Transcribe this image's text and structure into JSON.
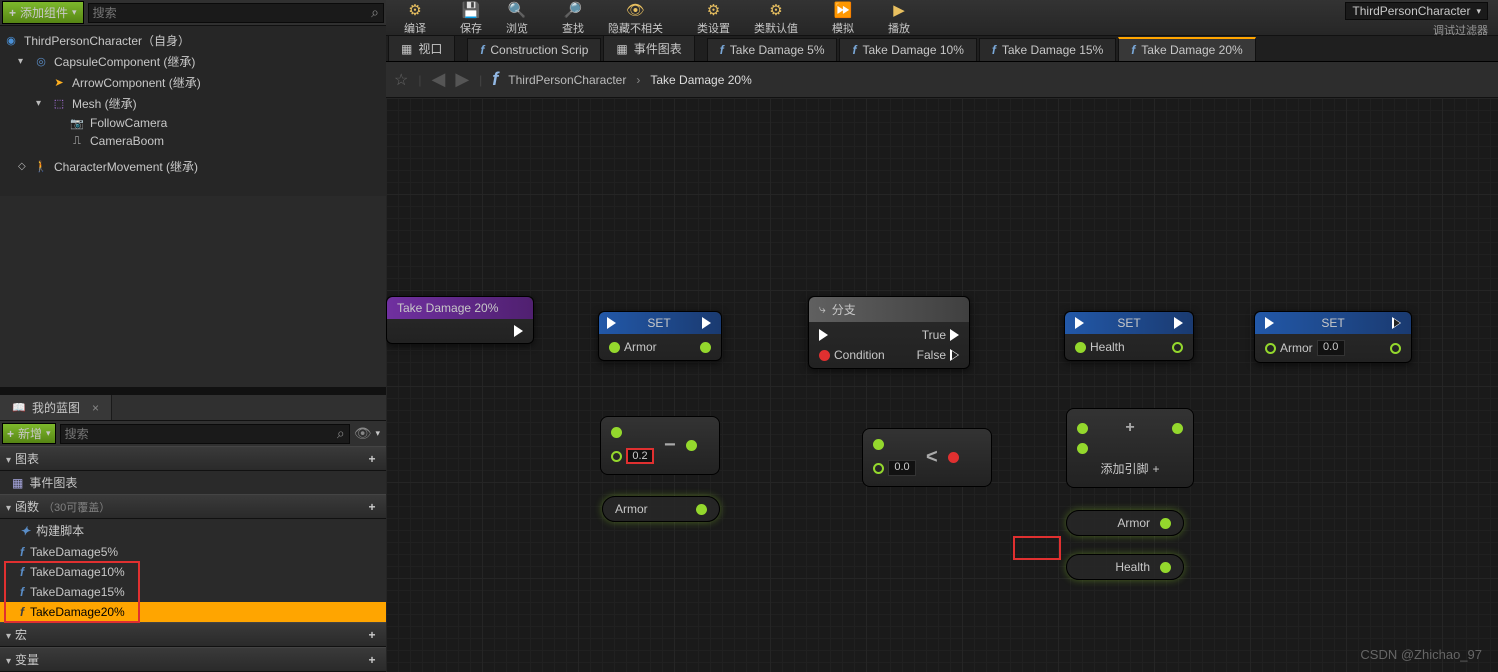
{
  "sidebar": {
    "add_component_label": "添加组件",
    "search_placeholder": "搜索",
    "root_item": "ThirdPersonCharacter（自身）",
    "tree": [
      {
        "label": "CapsuleComponent (继承)",
        "indent": 1,
        "exp": "▼",
        "ico": "ico-cap"
      },
      {
        "label": "ArrowComponent (继承)",
        "indent": 2,
        "exp": "",
        "ico": "ico-arrow"
      },
      {
        "label": "Mesh (继承)",
        "indent": 2,
        "exp": "▼",
        "ico": "ico-mesh"
      },
      {
        "label": "FollowCamera",
        "indent": 3,
        "exp": "",
        "ico": "ico-cam"
      },
      {
        "label": "CameraBoom",
        "indent": 3,
        "exp": "",
        "ico": "ico-boom"
      },
      {
        "label": "CharacterMovement (继承)",
        "indent": 1,
        "exp": "",
        "ico": "ico-move"
      }
    ]
  },
  "my_bp": {
    "tab_label": "我的蓝图",
    "add_new_label": "新增",
    "search_placeholder": "搜索",
    "section_charts": "图表",
    "section_event": "事件图表",
    "section_fn": "函数",
    "section_fn_sub": "（30可覆盖）",
    "section_macro": "宏",
    "section_var": "变量",
    "fns": [
      {
        "label": "构建脚本",
        "ico": "✦"
      },
      {
        "label": "TakeDamage5%",
        "ico": "f"
      },
      {
        "label": "TakeDamage10%",
        "ico": "f"
      },
      {
        "label": "TakeDamage15%",
        "ico": "f"
      },
      {
        "label": "TakeDamage20%",
        "ico": "f",
        "sel": true
      }
    ]
  },
  "toolbar": {
    "compile": "编译",
    "save": "保存",
    "browse": "浏览",
    "find": "查找",
    "hide": "隐藏不相关",
    "class_set": "类设置",
    "class_def": "类默认值",
    "simulate": "模拟",
    "play": "播放",
    "dropdown": "ThirdPersonCharacter",
    "filter": "调试过滤器"
  },
  "tabs": {
    "viewport": "视口",
    "cs": "Construction Scrip",
    "event": "事件图表",
    "td5": "Take Damage 5%",
    "td10": "Take Damage 10%",
    "td15": "Take Damage 15%",
    "td20": "Take Damage 20%"
  },
  "breadcrumb": {
    "class": "ThirdPersonCharacter",
    "fn": "Take Damage 20%"
  },
  "graph": {
    "entry_title": "Take Damage 20%",
    "set": "SET",
    "branch": "分支",
    "armor": "Armor",
    "health": "Health",
    "condition": "Condition",
    "true": "True",
    "false": "False",
    "add_pin": "添加引脚",
    "val_02": "0.2",
    "val_00": "0.0",
    "val_armor": "0.0"
  },
  "watermark": "CSDN @Zhichao_97"
}
